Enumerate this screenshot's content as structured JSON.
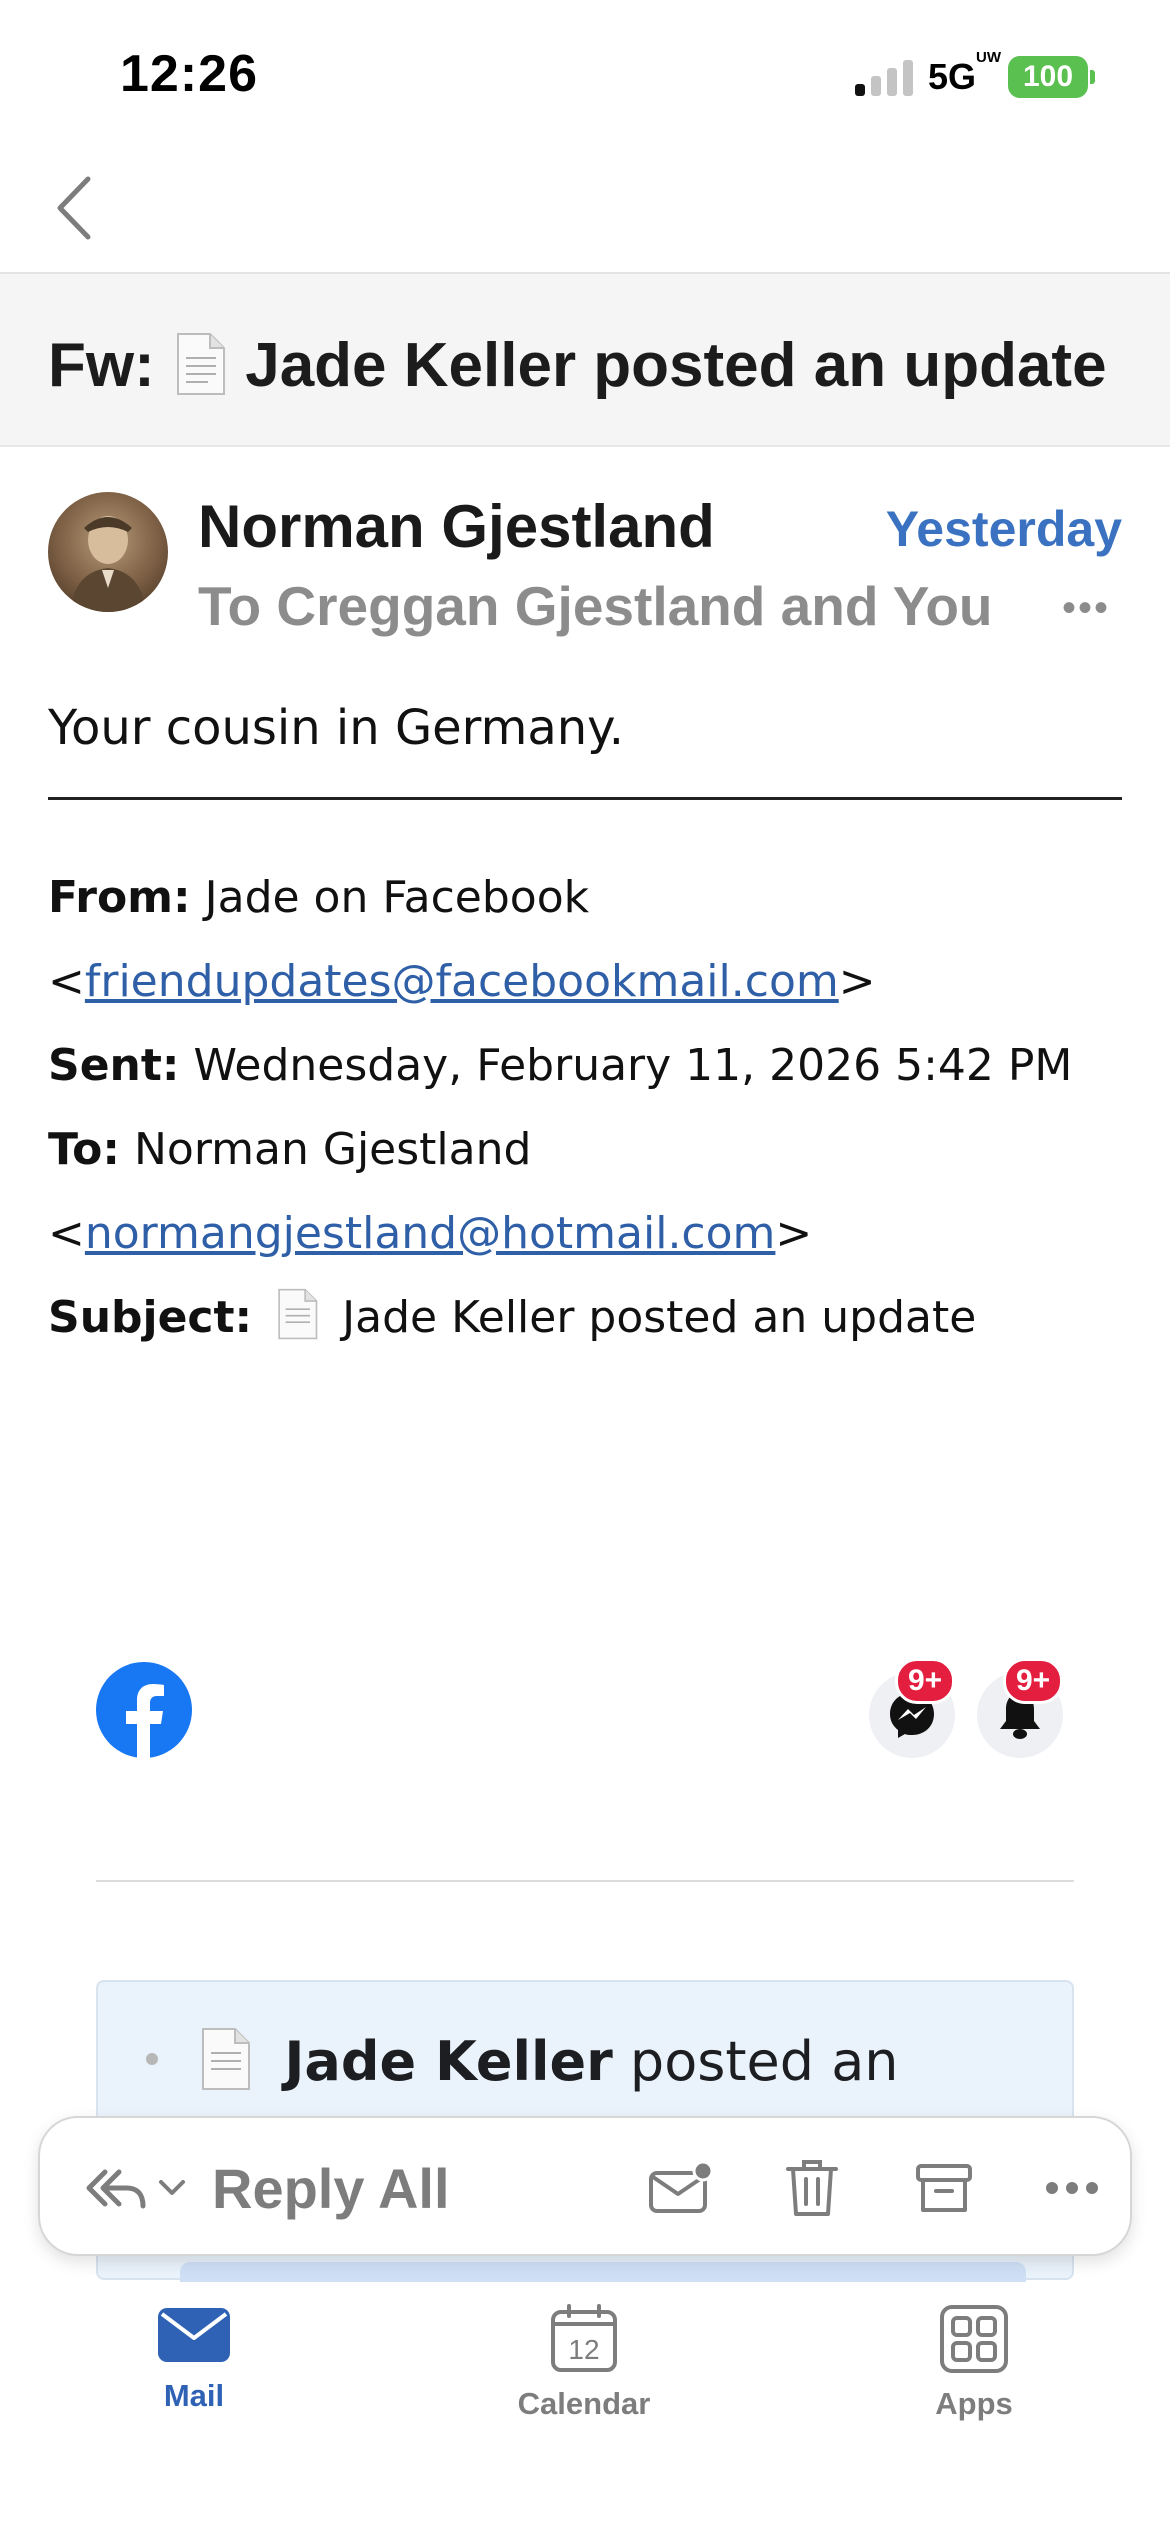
{
  "status_bar": {
    "time": "12:26",
    "network": "5G",
    "network_sup": "UW",
    "battery": "100"
  },
  "email": {
    "subject": "Fw: 📄 Jade Keller posted an update",
    "subject_prefix": "Fw:",
    "subject_rest": "Jade Keller posted an update",
    "sender_name": "Norman Gjestland",
    "date": "Yesterday",
    "recipients": "To Creggan  Gjestland and You",
    "body_line": "Your cousin in Germany.",
    "forward_header": {
      "from_label": "From:",
      "from_name": "Jade on Facebook",
      "from_email": "friendupdates@facebookmail.com",
      "sent_label": "Sent:",
      "sent_value": "Wednesday, February 11, 2026 5:42 PM",
      "to_label": "To:",
      "to_name": "Norman Gjestland",
      "to_email": "normangjestland@hotmail.com",
      "subject_label": "Subject:",
      "subject_value": "Jade Keller posted an update"
    },
    "facebook": {
      "messenger_badge": "9+",
      "notifications_badge": "9+",
      "card_name": "Jade Keller",
      "card_text": "posted an"
    }
  },
  "action_bar": {
    "reply_all_label": "Reply All"
  },
  "tabs": [
    {
      "label": "Mail",
      "active": true
    },
    {
      "label": "Calendar",
      "active": false,
      "icon_text": "12"
    },
    {
      "label": "Apps",
      "active": false
    }
  ],
  "colors": {
    "accent": "#2f62b5",
    "date": "#3a72c1",
    "facebook": "#1877f2",
    "badge": "#e41e3f",
    "battery": "#5ac050"
  }
}
